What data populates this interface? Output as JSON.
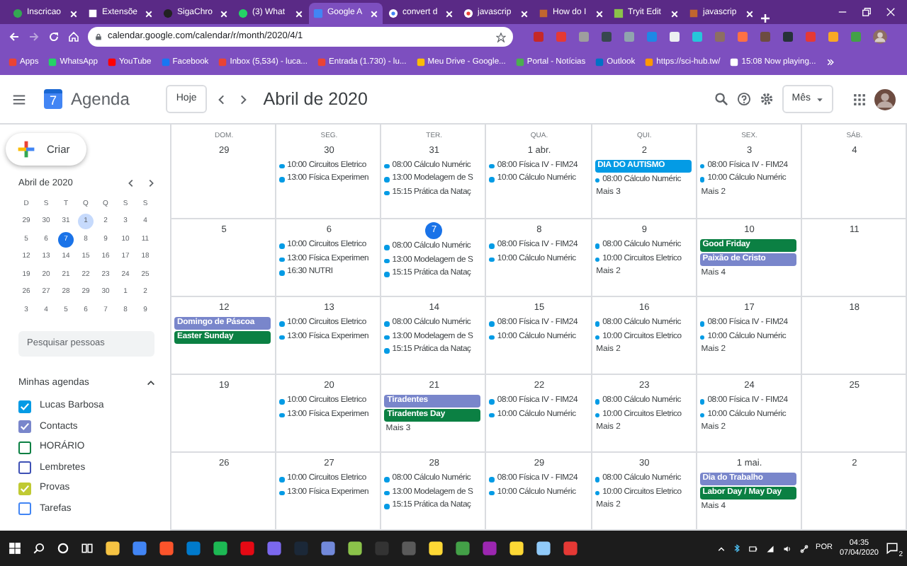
{
  "browser": {
    "tabs": [
      {
        "title": "Inscricao",
        "selected": false
      },
      {
        "title": "Extensõe",
        "selected": false
      },
      {
        "title": "SigaChro",
        "selected": false
      },
      {
        "title": "(3) What",
        "selected": false
      },
      {
        "title": "Google A",
        "selected": true
      },
      {
        "title": "convert d",
        "selected": false
      },
      {
        "title": "javascrip",
        "selected": false
      },
      {
        "title": "How do I",
        "selected": false
      },
      {
        "title": "Tryit Edit",
        "selected": false
      },
      {
        "title": "javascrip",
        "selected": false
      }
    ],
    "address": "calendar.google.com/calendar/r/month/2020/4/1",
    "bookmarks": [
      "Apps",
      "WhatsApp",
      "YouTube",
      "Facebook",
      "Inbox (5,534) - luca...",
      "Entrada (1.730) - lu...",
      "Meu Drive - Google...",
      "Portal - Notícias",
      "Outlook",
      "https://sci-hub.tw/",
      "15:08 Now playing..."
    ]
  },
  "header": {
    "logo_day": "7",
    "app_name": "Agenda",
    "today_button": "Hoje",
    "title": "Abril de 2020",
    "view": "Mês"
  },
  "sidebar": {
    "create_button": "Criar",
    "mini_calendar": {
      "title": "Abril de 2020",
      "weekdays": [
        "D",
        "S",
        "T",
        "Q",
        "Q",
        "S",
        "S"
      ],
      "weeks": [
        [
          {
            "day": "29",
            "selected": false,
            "today": false
          },
          {
            "day": "30",
            "selected": false,
            "today": false
          },
          {
            "day": "31",
            "selected": false,
            "today": false
          },
          {
            "day": "1",
            "selected": true,
            "today": false
          },
          {
            "day": "2",
            "selected": false,
            "today": false
          },
          {
            "day": "3",
            "selected": false,
            "today": false
          },
          {
            "day": "4",
            "selected": false,
            "today": false
          }
        ],
        [
          {
            "day": "5",
            "selected": false,
            "today": false
          },
          {
            "day": "6",
            "selected": false,
            "today": false
          },
          {
            "day": "7",
            "selected": false,
            "today": true
          },
          {
            "day": "8",
            "selected": false,
            "today": false
          },
          {
            "day": "9",
            "selected": false,
            "today": false
          },
          {
            "day": "10",
            "selected": false,
            "today": false
          },
          {
            "day": "11",
            "selected": false,
            "today": false
          }
        ],
        [
          {
            "day": "12",
            "selected": false,
            "today": false
          },
          {
            "day": "13",
            "selected": false,
            "today": false
          },
          {
            "day": "14",
            "selected": false,
            "today": false
          },
          {
            "day": "15",
            "selected": false,
            "today": false
          },
          {
            "day": "16",
            "selected": false,
            "today": false
          },
          {
            "day": "17",
            "selected": false,
            "today": false
          },
          {
            "day": "18",
            "selected": false,
            "today": false
          }
        ],
        [
          {
            "day": "19",
            "selected": false,
            "today": false
          },
          {
            "day": "20",
            "selected": false,
            "today": false
          },
          {
            "day": "21",
            "selected": false,
            "today": false
          },
          {
            "day": "22",
            "selected": false,
            "today": false
          },
          {
            "day": "23",
            "selected": false,
            "today": false
          },
          {
            "day": "24",
            "selected": false,
            "today": false
          },
          {
            "day": "25",
            "selected": false,
            "today": false
          }
        ],
        [
          {
            "day": "26",
            "selected": false,
            "today": false
          },
          {
            "day": "27",
            "selected": false,
            "today": false
          },
          {
            "day": "28",
            "selected": false,
            "today": false
          },
          {
            "day": "29",
            "selected": false,
            "today": false
          },
          {
            "day": "30",
            "selected": false,
            "today": false
          },
          {
            "day": "1",
            "selected": false,
            "today": false
          },
          {
            "day": "2",
            "selected": false,
            "today": false
          }
        ],
        [
          {
            "day": "3",
            "selected": false,
            "today": false
          },
          {
            "day": "4",
            "selected": false,
            "today": false
          },
          {
            "day": "5",
            "selected": false,
            "today": false
          },
          {
            "day": "6",
            "selected": false,
            "today": false
          },
          {
            "day": "7",
            "selected": false,
            "today": false
          },
          {
            "day": "8",
            "selected": false,
            "today": false
          },
          {
            "day": "9",
            "selected": false,
            "today": false
          }
        ]
      ]
    },
    "search": {
      "placeholder": "Pesquisar pessoas"
    },
    "my_calendars": {
      "title": "Minhas agendas",
      "expanded": true,
      "items": [
        {
          "name": "Lucas Barbosa",
          "checked": true,
          "color": "#039be5"
        },
        {
          "name": "Contacts",
          "checked": true,
          "color": "#7986cb"
        },
        {
          "name": "HORÁRIO",
          "checked": false,
          "color": "#0b8043"
        },
        {
          "name": "Lembretes",
          "checked": false,
          "color": "#3f51b5"
        },
        {
          "name": "Provas",
          "checked": true,
          "color": "#c0ca33"
        },
        {
          "name": "Tarefas",
          "checked": false,
          "color": "#4285f4"
        }
      ]
    }
  },
  "calendar": {
    "weekdays": [
      "DOM.",
      "SEG.",
      "TER.",
      "QUA.",
      "QUI.",
      "SEX.",
      "SÁB."
    ],
    "weeks": [
      {
        "days": [
          {
            "date": "29",
            "today": false
          },
          {
            "date": "30",
            "today": false,
            "events": [
              {
                "kind": "timed",
                "time": "10:00",
                "title": "Circuitos Eletrico",
                "color": "#039be5"
              },
              {
                "kind": "timed",
                "time": "13:00",
                "title": "Física Experimen",
                "color": "#039be5"
              }
            ]
          },
          {
            "date": "31",
            "today": false,
            "events": [
              {
                "kind": "timed",
                "time": "08:00",
                "title": "Cálculo Numéric",
                "color": "#039be5"
              },
              {
                "kind": "timed",
                "time": "13:00",
                "title": "Modelagem de S",
                "color": "#039be5"
              },
              {
                "kind": "timed",
                "time": "15:15",
                "title": "Prática da Nataç",
                "color": "#039be5"
              }
            ]
          },
          {
            "date": "1 abr.",
            "today": false,
            "events": [
              {
                "kind": "timed",
                "time": "08:00",
                "title": "Física IV - FIM24",
                "color": "#039be5"
              },
              {
                "kind": "timed",
                "time": "10:00",
                "title": "Cálculo Numéric",
                "color": "#039be5"
              }
            ]
          },
          {
            "date": "2",
            "today": false,
            "events": [
              {
                "kind": "allday",
                "title": "DIA DO AUTISMO",
                "color": "#039be5"
              },
              {
                "kind": "timed",
                "time": "08:00",
                "title": "Cálculo Numéric",
                "color": "#039be5"
              }
            ],
            "more": "Mais 3"
          },
          {
            "date": "3",
            "today": false,
            "events": [
              {
                "kind": "timed",
                "time": "08:00",
                "title": "Física IV - FIM24",
                "color": "#039be5"
              },
              {
                "kind": "timed",
                "time": "10:00",
                "title": "Cálculo Numéric",
                "color": "#039be5"
              }
            ],
            "more": "Mais 2"
          },
          {
            "date": "4",
            "today": false
          }
        ]
      },
      {
        "days": [
          {
            "date": "5",
            "today": false
          },
          {
            "date": "6",
            "today": false,
            "events": [
              {
                "kind": "timed",
                "time": "10:00",
                "title": "Circuitos Eletrico",
                "color": "#039be5"
              },
              {
                "kind": "timed",
                "time": "13:00",
                "title": "Física Experimen",
                "color": "#039be5"
              },
              {
                "kind": "timed",
                "time": "16:30",
                "title": "NUTRI",
                "color": "#039be5"
              }
            ]
          },
          {
            "date": "7",
            "today": true,
            "events": [
              {
                "kind": "timed",
                "time": "08:00",
                "title": "Cálculo Numéric",
                "color": "#039be5"
              },
              {
                "kind": "timed",
                "time": "13:00",
                "title": "Modelagem de S",
                "color": "#039be5"
              },
              {
                "kind": "timed",
                "time": "15:15",
                "title": "Prática da Nataç",
                "color": "#039be5"
              }
            ]
          },
          {
            "date": "8",
            "today": false,
            "events": [
              {
                "kind": "timed",
                "time": "08:00",
                "title": "Física IV - FIM24",
                "color": "#039be5"
              },
              {
                "kind": "timed",
                "time": "10:00",
                "title": "Cálculo Numéric",
                "color": "#039be5"
              }
            ]
          },
          {
            "date": "9",
            "today": false,
            "events": [
              {
                "kind": "timed",
                "time": "08:00",
                "title": "Cálculo Numéric",
                "color": "#039be5"
              },
              {
                "kind": "timed",
                "time": "10:00",
                "title": "Circuitos Eletrico",
                "color": "#039be5"
              }
            ],
            "more": "Mais 2"
          },
          {
            "date": "10",
            "today": false,
            "events": [
              {
                "kind": "allday",
                "title": "Good Friday",
                "color": "#0b8043"
              },
              {
                "kind": "allday",
                "title": "Paixão de Cristo",
                "color": "#7986cb"
              }
            ],
            "more": "Mais 4"
          },
          {
            "date": "11",
            "today": false
          }
        ]
      },
      {
        "days": [
          {
            "date": "12",
            "today": false,
            "events": [
              {
                "kind": "allday",
                "title": "Domingo de Páscoa",
                "color": "#7986cb"
              },
              {
                "kind": "allday",
                "title": "Easter Sunday",
                "color": "#0b8043"
              }
            ]
          },
          {
            "date": "13",
            "today": false,
            "events": [
              {
                "kind": "timed",
                "time": "10:00",
                "title": "Circuitos Eletrico",
                "color": "#039be5"
              },
              {
                "kind": "timed",
                "time": "13:00",
                "title": "Física Experimen",
                "color": "#039be5"
              }
            ]
          },
          {
            "date": "14",
            "today": false,
            "events": [
              {
                "kind": "timed",
                "time": "08:00",
                "title": "Cálculo Numéric",
                "color": "#039be5"
              },
              {
                "kind": "timed",
                "time": "13:00",
                "title": "Modelagem de S",
                "color": "#039be5"
              },
              {
                "kind": "timed",
                "time": "15:15",
                "title": "Prática da Nataç",
                "color": "#039be5"
              }
            ]
          },
          {
            "date": "15",
            "today": false,
            "events": [
              {
                "kind": "timed",
                "time": "08:00",
                "title": "Física IV - FIM24",
                "color": "#039be5"
              },
              {
                "kind": "timed",
                "time": "10:00",
                "title": "Cálculo Numéric",
                "color": "#039be5"
              }
            ]
          },
          {
            "date": "16",
            "today": false,
            "events": [
              {
                "kind": "timed",
                "time": "08:00",
                "title": "Cálculo Numéric",
                "color": "#039be5"
              },
              {
                "kind": "timed",
                "time": "10:00",
                "title": "Circuitos Eletrico",
                "color": "#039be5"
              }
            ],
            "more": "Mais 2"
          },
          {
            "date": "17",
            "today": false,
            "events": [
              {
                "kind": "timed",
                "time": "08:00",
                "title": "Física IV - FIM24",
                "color": "#039be5"
              },
              {
                "kind": "timed",
                "time": "10:00",
                "title": "Cálculo Numéric",
                "color": "#039be5"
              }
            ],
            "more": "Mais 2"
          },
          {
            "date": "18",
            "today": false
          }
        ]
      },
      {
        "days": [
          {
            "date": "19",
            "today": false
          },
          {
            "date": "20",
            "today": false,
            "events": [
              {
                "kind": "timed",
                "time": "10:00",
                "title": "Circuitos Eletrico",
                "color": "#039be5"
              },
              {
                "kind": "timed",
                "time": "13:00",
                "title": "Física Experimen",
                "color": "#039be5"
              }
            ]
          },
          {
            "date": "21",
            "today": false,
            "events": [
              {
                "kind": "allday",
                "title": "Tiradentes",
                "color": "#7986cb"
              },
              {
                "kind": "allday",
                "title": "Tiradentes Day",
                "color": "#0b8043"
              }
            ],
            "more": "Mais 3"
          },
          {
            "date": "22",
            "today": false,
            "events": [
              {
                "kind": "timed",
                "time": "08:00",
                "title": "Física IV - FIM24",
                "color": "#039be5"
              },
              {
                "kind": "timed",
                "time": "10:00",
                "title": "Cálculo Numéric",
                "color": "#039be5"
              }
            ]
          },
          {
            "date": "23",
            "today": false,
            "events": [
              {
                "kind": "timed",
                "time": "08:00",
                "title": "Cálculo Numéric",
                "color": "#039be5"
              },
              {
                "kind": "timed",
                "time": "10:00",
                "title": "Circuitos Eletrico",
                "color": "#039be5"
              }
            ],
            "more": "Mais 2"
          },
          {
            "date": "24",
            "today": false,
            "events": [
              {
                "kind": "timed",
                "time": "08:00",
                "title": "Física IV - FIM24",
                "color": "#039be5"
              },
              {
                "kind": "timed",
                "time": "10:00",
                "title": "Cálculo Numéric",
                "color": "#039be5"
              }
            ],
            "more": "Mais 2"
          },
          {
            "date": "25",
            "today": false
          }
        ]
      },
      {
        "days": [
          {
            "date": "26",
            "today": false
          },
          {
            "date": "27",
            "today": false,
            "events": [
              {
                "kind": "timed",
                "time": "10:00",
                "title": "Circuitos Eletrico",
                "color": "#039be5"
              },
              {
                "kind": "timed",
                "time": "13:00",
                "title": "Física Experimen",
                "color": "#039be5"
              }
            ]
          },
          {
            "date": "28",
            "today": false,
            "events": [
              {
                "kind": "timed",
                "time": "08:00",
                "title": "Cálculo Numéric",
                "color": "#039be5"
              },
              {
                "kind": "timed",
                "time": "13:00",
                "title": "Modelagem de S",
                "color": "#039be5"
              },
              {
                "kind": "timed",
                "time": "15:15",
                "title": "Prática da Nataç",
                "color": "#039be5"
              }
            ]
          },
          {
            "date": "29",
            "today": false,
            "events": [
              {
                "kind": "timed",
                "time": "08:00",
                "title": "Física IV - FIM24",
                "color": "#039be5"
              },
              {
                "kind": "timed",
                "time": "10:00",
                "title": "Cálculo Numéric",
                "color": "#039be5"
              }
            ]
          },
          {
            "date": "30",
            "today": false,
            "events": [
              {
                "kind": "timed",
                "time": "08:00",
                "title": "Cálculo Numéric",
                "color": "#039be5"
              },
              {
                "kind": "timed",
                "time": "10:00",
                "title": "Circuitos Eletrico",
                "color": "#039be5"
              }
            ],
            "more": "Mais 2"
          },
          {
            "date": "1 mai.",
            "today": false,
            "events": [
              {
                "kind": "allday",
                "title": "Dia do Trabalho",
                "color": "#7986cb"
              },
              {
                "kind": "allday",
                "title": "Labor Day / May Day",
                "color": "#0b8043"
              }
            ],
            "more": "Mais 4"
          },
          {
            "date": "2",
            "today": false
          }
        ]
      }
    ]
  },
  "taskbar": {
    "language": "POR",
    "time": "04:35",
    "date": "07/04/2020",
    "notifications": "2"
  }
}
